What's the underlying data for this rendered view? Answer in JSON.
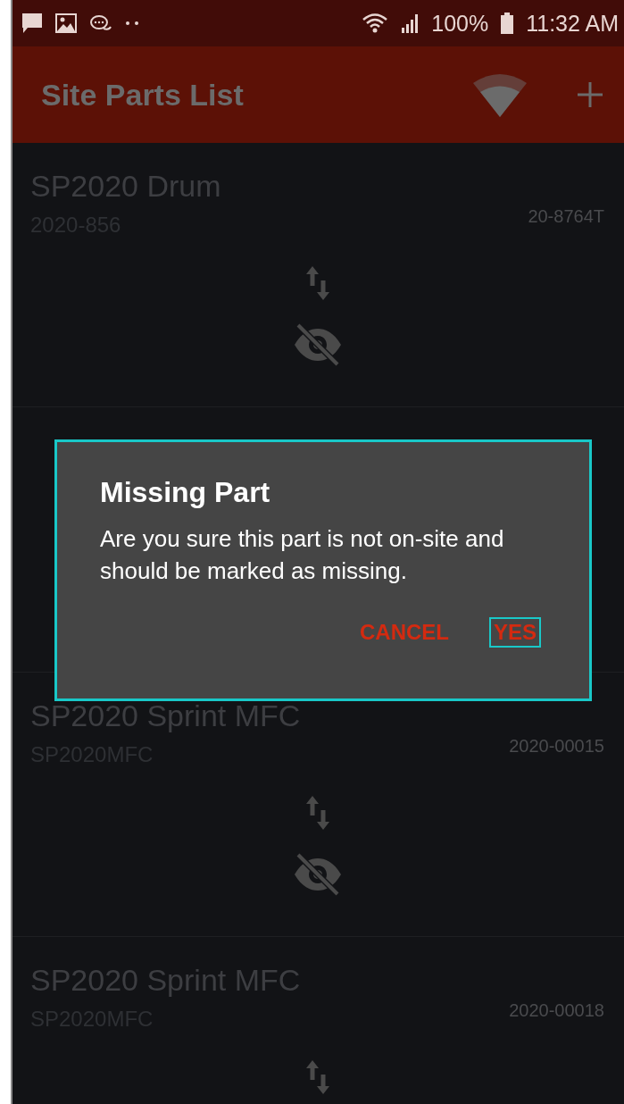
{
  "status_bar": {
    "battery": "100%",
    "time": "11:32 AM"
  },
  "app_bar": {
    "title": "Site Parts List"
  },
  "parts": [
    {
      "name": "SP2020 Drum",
      "code": "2020-856",
      "serial": "20-8764T",
      "hidden": true
    },
    {
      "name": "SP2020 Sprint MFC",
      "code": "SP2020MFC",
      "serial": "2020-00015",
      "hidden": true
    },
    {
      "name": "SP2020 Sprint MFC",
      "code": "SP2020MFC",
      "serial": "2020-00018"
    }
  ],
  "dialog": {
    "title": "Missing Part",
    "message": "Are you sure this part is not on-site and should be marked as missing.",
    "highlighted": true,
    "buttons": [
      {
        "label": "CANCEL",
        "highlighted": false
      },
      {
        "label": "YES",
        "highlighted": true
      }
    ]
  }
}
